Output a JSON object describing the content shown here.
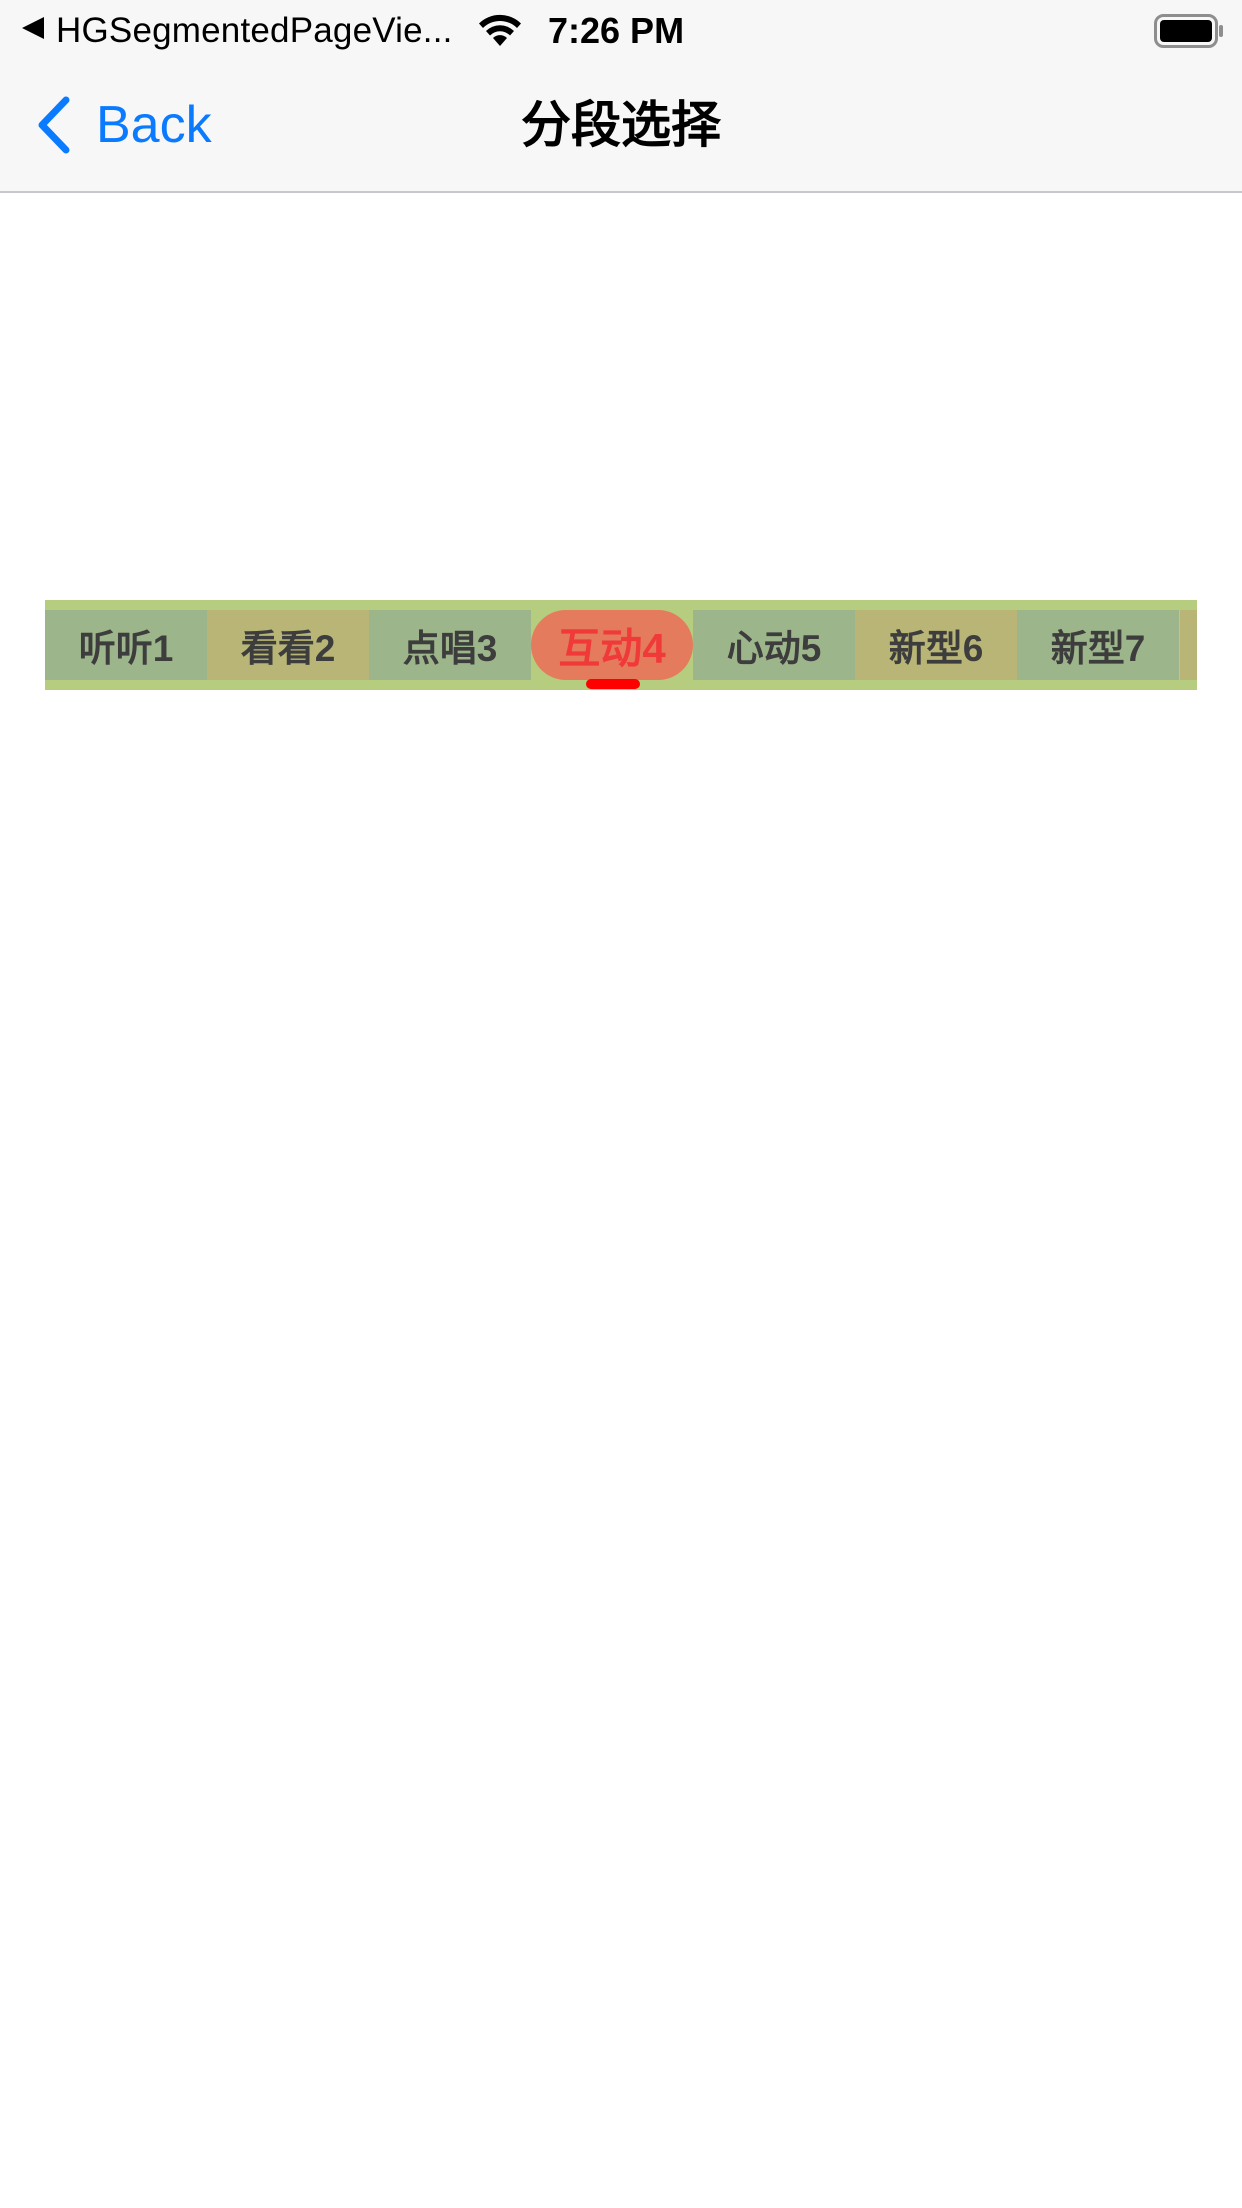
{
  "status_bar": {
    "back_app_name": "HGSegmentedPageVie...",
    "time": "7:26 PM"
  },
  "nav_bar": {
    "back_label": "Back",
    "title": "分段选择"
  },
  "segments": {
    "items": [
      "听听1",
      "看看2",
      "点唱3",
      "互动4",
      "心动5",
      "新型6",
      "新型7"
    ],
    "selected": "互动4",
    "colors": {
      "bar_background": "#b6cc7f",
      "item_green": "#9db58a",
      "item_olive": "#b8b576",
      "selected_pill": "#e47b5d",
      "selected_text": "#f03a3a",
      "indicator": "#ff0000"
    }
  },
  "colors": {
    "accent": "#0a7aff",
    "nav_background": "#f7f7f7"
  }
}
